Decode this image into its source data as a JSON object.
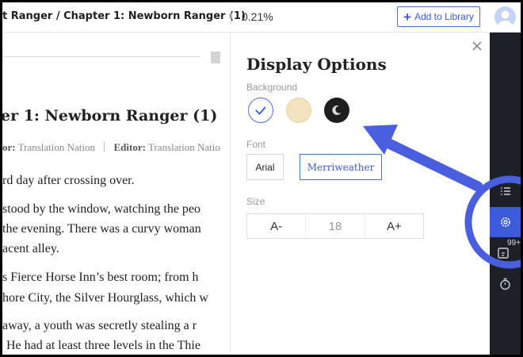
{
  "header": {
    "book_chapter_title": "t Ranger / Chapter 1: Newborn Ranger (1)",
    "progress": "0.21%",
    "add_to_library_label": "Add to Library"
  },
  "reader": {
    "chapter_heading": "er 1: Newborn Ranger (1)",
    "credits": {
      "translator_label": "or:",
      "translator_name": "Translation Nation",
      "editor_label": "Editor:",
      "editor_name": "Translation Natio"
    },
    "lines": [
      "rd day after crossing over.",
      "stood by the window, watching the peo",
      "the evening. There was a curvy woman",
      "acent alley.",
      "s Fierce Horse Inn’s best room; from h",
      "hore City, the Silver Hourglass, which w",
      "away, a youth was secretly stealing a r",
      "He had at least three levels in the Thie"
    ]
  },
  "display_options": {
    "title": "Display Options",
    "background_label": "Background",
    "background_options": [
      "white",
      "sepia",
      "dark"
    ],
    "selected_background": "white",
    "font_label": "Font",
    "font_options": [
      "Arial",
      "Merriweather"
    ],
    "selected_font": "Merriweather",
    "size_label": "Size",
    "size_decrease": "A-",
    "size_value": "18",
    "size_increase": "A+"
  },
  "sidebar": {
    "items": [
      "toc-icon",
      "settings-icon",
      "comments-icon",
      "timer-icon"
    ],
    "selected": "settings-icon",
    "comments_badge": "99+"
  },
  "colors": {
    "accent": "#3b5bdb",
    "annotation": "#4a5fe0",
    "sidebar_bg": "#1e2027",
    "sepia": "#f3e4bf",
    "dark": "#1e1e1e"
  }
}
